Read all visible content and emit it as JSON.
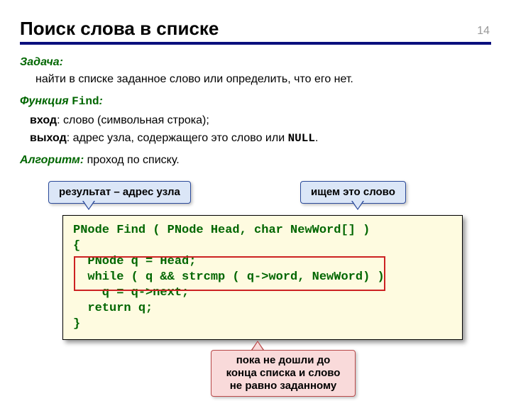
{
  "page_number": "14",
  "title": "Поиск слова в списке",
  "task": {
    "label": "Задача:",
    "text": "найти в списке заданное слово или определить, что его нет."
  },
  "func": {
    "label_prefix": "Функция ",
    "name": "Find",
    "label_suffix": ":",
    "input_label": "вход",
    "input_text": ":   слово (символьная строка);",
    "output_label": "выход",
    "output_text_a": ": адрес узла, содержащего это слово или ",
    "null_code": "NULL",
    "output_text_b": "."
  },
  "algo": {
    "label": "Алгоритм:",
    "text": " проход по списку."
  },
  "callouts": {
    "left": "результат – адрес узла",
    "right": "ищем это слово",
    "bottom": "пока не дошли до конца списка и слово не равно заданному"
  },
  "code": "PNode Find ( PNode Head, char NewWord[] )\n{\n  PNode q = Head;\n  while ( q && strcmp ( q->word, NewWord) )\n    q = q->next;\n  return q;\n}"
}
